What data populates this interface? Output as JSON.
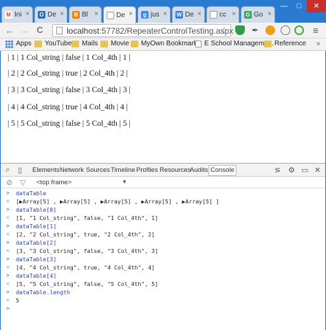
{
  "tabs": [
    {
      "label": "Ini",
      "favicon": "gmail-icon",
      "color": "#d44638",
      "glyph": "M"
    },
    {
      "label": "De",
      "favicon": "outlook-icon",
      "color": "#1b6fc5",
      "glyph": "O"
    },
    {
      "label": "Bl",
      "favicon": "blogger-icon",
      "color": "#f57d00",
      "glyph": "B"
    },
    {
      "label": "De",
      "favicon": "page-icon",
      "color": "#aaaaaa",
      "glyph": ""
    },
    {
      "label": "jus",
      "favicon": "google-icon",
      "color": "#4285f4",
      "glyph": "g"
    },
    {
      "label": "De",
      "favicon": "wp-icon",
      "color": "#3a7bd5",
      "glyph": "W"
    },
    {
      "label": "cc",
      "favicon": "page-icon",
      "color": "#aaaaaa",
      "glyph": ""
    },
    {
      "label": "Go",
      "favicon": "chrome-icon",
      "color": "#34a853",
      "glyph": "G"
    }
  ],
  "window_controls": {
    "minimize": "—",
    "maximize": "□",
    "close": "✕"
  },
  "toolbar": {
    "back": "←",
    "forward": "→",
    "reload": "C",
    "url_host": "localhost",
    "url_path": ":57782/RepeaterControlTesting.aspx",
    "star": "☆",
    "menu": "≡"
  },
  "bookmarks": {
    "items": [
      {
        "label": "Apps",
        "icon": "apps-icon"
      },
      {
        "label": "YouTube",
        "icon": "folder-icon"
      },
      {
        "label": "Mails",
        "icon": "folder-icon"
      },
      {
        "label": "Movie",
        "icon": "folder-icon"
      },
      {
        "label": "MyOwn Bookmarks",
        "icon": "folder-icon"
      },
      {
        "label": "E School Manageme...",
        "icon": "page-icon"
      },
      {
        "label": "Reference",
        "icon": "folder-icon"
      }
    ],
    "more": "»"
  },
  "page": {
    "rows": [
      "| 1 | 1 Col_string | false | 1 Col_4th | 1 |",
      "| 2 | 2 Col_string | true | 2 Col_4th | 2 |",
      "| 3 | 3 Col_string | false | 3 Col_4th | 3 |",
      "| 4 | 4 Col_string | true | 4 Col_4th | 4 |",
      "| 5 | 5 Col_string | false | 5 Col_4th | 5 |"
    ]
  },
  "devtools": {
    "tabs": [
      "Elements",
      "Network",
      "Sources",
      "Timeline",
      "Profiles",
      "Resources",
      "Audits",
      "Console"
    ],
    "active_tab": "Console",
    "frame_selector": "<top frame>",
    "frame_arrow": "▼",
    "console_lines": [
      {
        "type": "input",
        "text": "dataTable"
      },
      {
        "type": "output",
        "text": "[▶Array[5] , ▶Array[5] , ▶Array[5] , ▶Array[5] , ▶Array[5] ]"
      },
      {
        "type": "input",
        "text": "dataTable[0]"
      },
      {
        "type": "output",
        "text": "[1, \"1  Col_string\", false, \"1 Col_4th\", 1]"
      },
      {
        "type": "input",
        "text": "dataTable[1]"
      },
      {
        "type": "output",
        "text": "[2, \"2  Col_string\", true, \"2 Col_4th\", 2]"
      },
      {
        "type": "input",
        "text": "dataTable[2]"
      },
      {
        "type": "output",
        "text": "[3, \"3  Col_string\", false, \"3 Col_4th\", 3]"
      },
      {
        "type": "input",
        "text": "dataTable[3]"
      },
      {
        "type": "output",
        "text": "[4, \"4  Col_string\", true, \"4 Col_4th\", 4]"
      },
      {
        "type": "input",
        "text": "dataTable[4]"
      },
      {
        "type": "output",
        "text": "[5, \"5  Col_string\", false, \"5 Col_4th\", 5]"
      },
      {
        "type": "input",
        "text": "dataTable.length"
      },
      {
        "type": "output",
        "text": "5"
      },
      {
        "type": "prompt",
        "text": ""
      }
    ],
    "input_marker": ">",
    "output_marker": "<"
  }
}
